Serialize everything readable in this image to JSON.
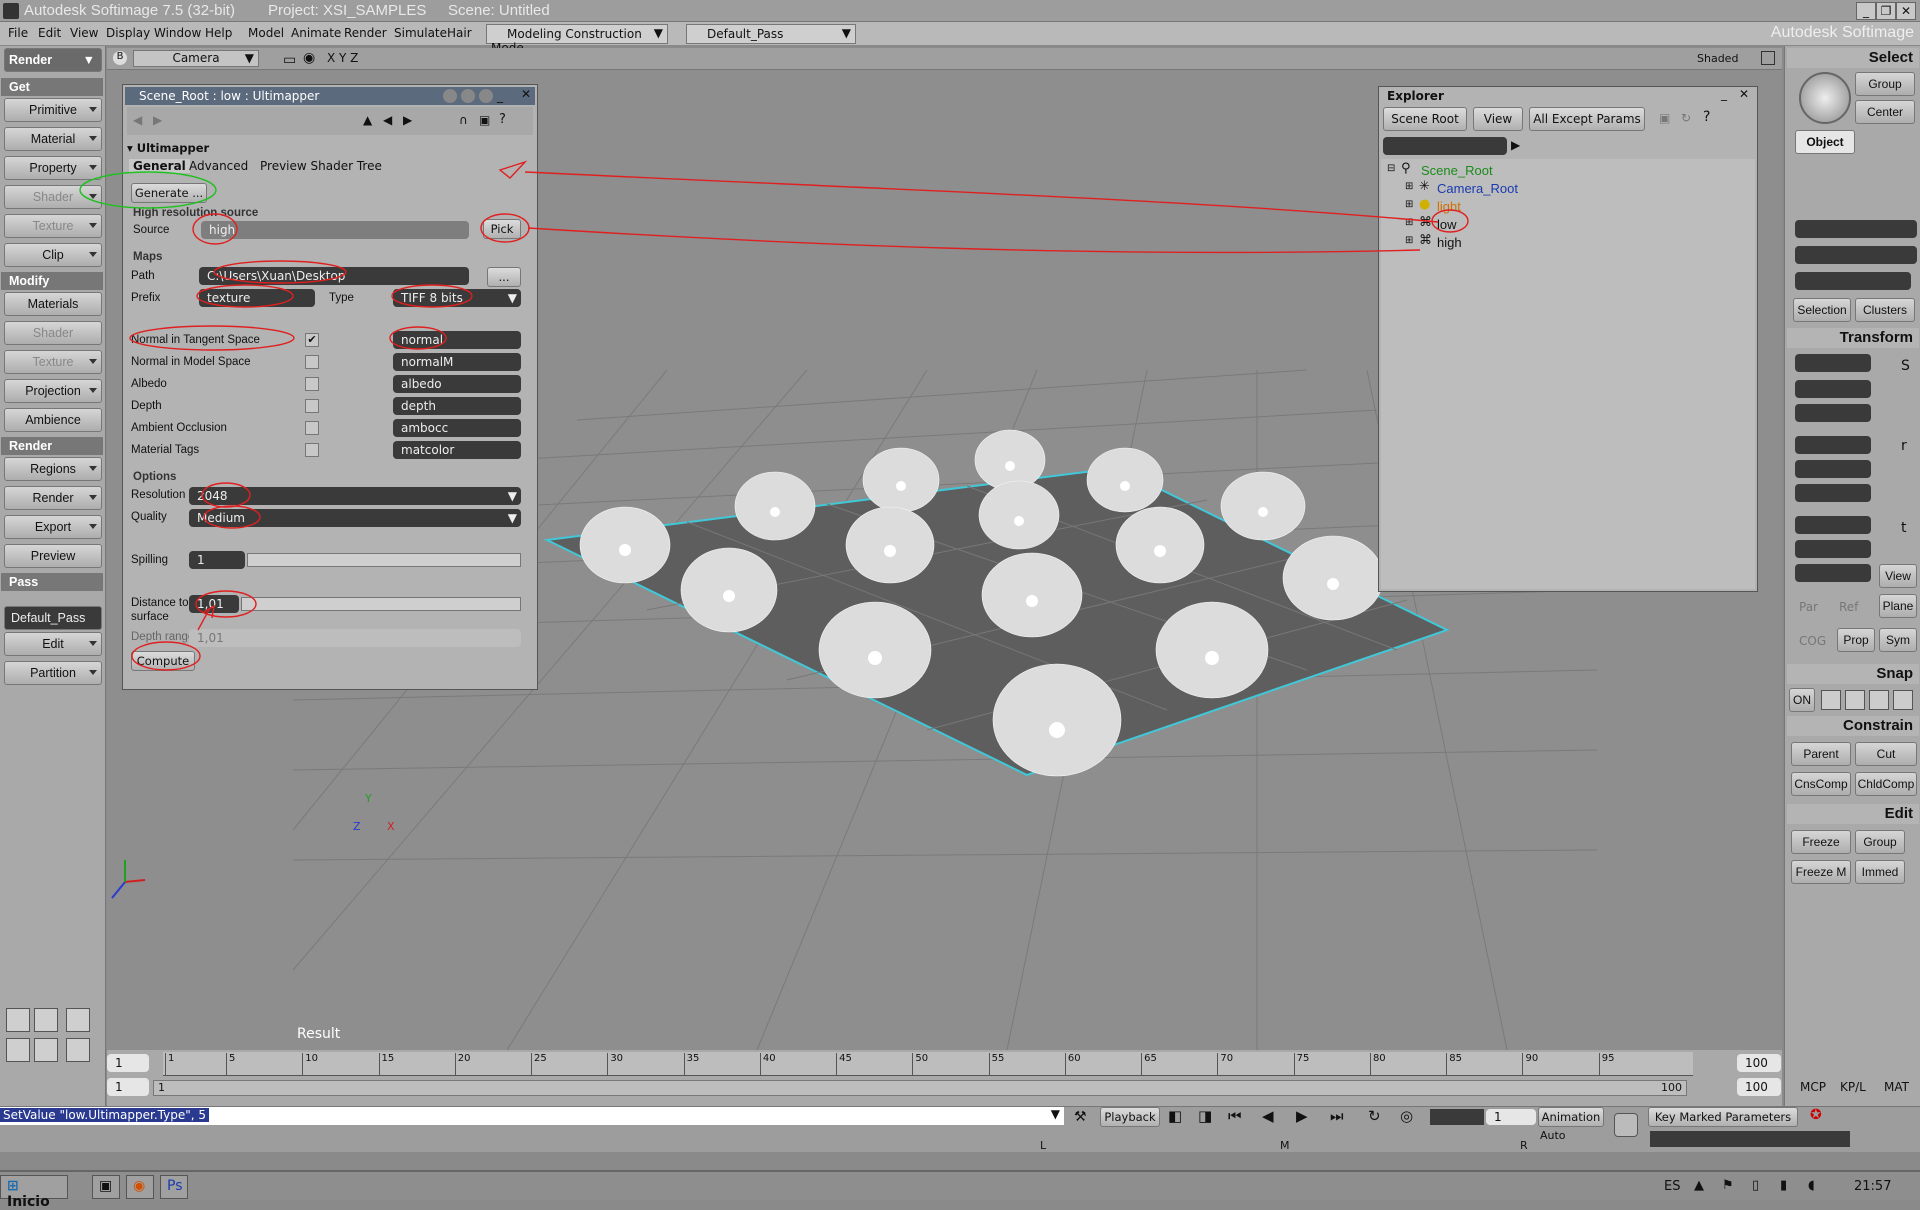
{
  "window": {
    "title_app": "Autodesk Softimage 7.5 (32-bit)",
    "title_project": "Project: XSI_SAMPLES",
    "title_scene": "Scene: Untitled",
    "brand": "Autodesk Softimage"
  },
  "menubar": {
    "items": [
      "File",
      "Edit",
      "View",
      "Display",
      "Window",
      "Help",
      "Model",
      "Animate",
      "Render",
      "Simulate",
      "Hair"
    ],
    "mode_combo": "Modeling Construction Mode",
    "pass_combo": "Default_Pass"
  },
  "left_panel": {
    "mode": "Render",
    "sections": {
      "get": "Get",
      "modify": "Modify",
      "render": "Render",
      "pass": "Pass"
    },
    "get_items": [
      "Primitive",
      "Material",
      "Property",
      "Shader",
      "Texture",
      "Clip"
    ],
    "modify_items": [
      "Materials",
      "Shader",
      "Texture",
      "Projection",
      "Ambience"
    ],
    "render_items": [
      "Regions",
      "Render",
      "Export",
      "Preview"
    ],
    "pass_value": "Default_Pass",
    "pass_items": [
      "Edit",
      "Partition"
    ]
  },
  "viewport": {
    "camera": "Camera",
    "axes_label": "X Y Z",
    "shading": "Shaded",
    "result_label": "Result",
    "axis_x": "X",
    "axis_y": "Y",
    "axis_z": "Z"
  },
  "ultimapper": {
    "title": "Scene_Root : low : Ultimapper",
    "section": "Ultimapper",
    "tabs": [
      "General",
      "Advanced",
      "Preview Shader Tree"
    ],
    "generate_btn": "Generate ...",
    "hires_section": "High resolution source",
    "source_label": "Source",
    "source_value": "high",
    "pick_btn": "Pick",
    "maps_section": "Maps",
    "path_label": "Path",
    "path_value": "C:\\Users\\Xuan\\Desktop",
    "browse_btn": "...",
    "prefix_label": "Prefix",
    "prefix_value": "texture",
    "type_label": "Type",
    "type_value": "TIFF 8 bits",
    "maps": [
      {
        "label": "Normal in Tangent Space",
        "checked": true,
        "name": "normal"
      },
      {
        "label": "Normal in Model Space",
        "checked": false,
        "name": "normalM"
      },
      {
        "label": "Albedo",
        "checked": false,
        "name": "albedo"
      },
      {
        "label": "Depth",
        "checked": false,
        "name": "depth"
      },
      {
        "label": "Ambient Occlusion",
        "checked": false,
        "name": "ambocc"
      },
      {
        "label": "Material Tags",
        "checked": false,
        "name": "matcolor"
      }
    ],
    "options_section": "Options",
    "resolution_label": "Resolution",
    "resolution_value": "2048",
    "quality_label": "Quality",
    "quality_value": "Medium",
    "spilling_label": "Spilling",
    "spilling_value": "1",
    "distance_label_1": "Distance to",
    "distance_label_2": "surface",
    "distance_value": "1,01",
    "depth_range_label": "Depth range",
    "depth_range_value": "1,01",
    "compute_btn": "Compute"
  },
  "explorer": {
    "title": "Explorer",
    "scope_btn": "Scene Root",
    "view_btn": "View",
    "filter_btn": "All Except Params",
    "tree": [
      {
        "label": "Scene_Root",
        "color": "#1a8a1a"
      },
      {
        "label": "Camera_Root",
        "color": "#1a3ab0"
      },
      {
        "label": "light",
        "color": "#d07000"
      },
      {
        "label": "low",
        "color": "#111111"
      },
      {
        "label": "high",
        "color": "#111111"
      }
    ]
  },
  "right_panel": {
    "select_header": "Select",
    "group_btn": "Group",
    "center_btn": "Center",
    "object_btn": "Object",
    "selection_btn": "Selection",
    "clusters_btn": "Clusters",
    "transform_header": "Transform",
    "view_btn": "View",
    "par_btn": "Par",
    "ref_btn": "Ref",
    "plane_btn": "Plane",
    "cog_btn": "COG",
    "prop_btn": "Prop",
    "sym_btn": "Sym",
    "snap_header": "Snap",
    "on_btn": "ON",
    "constrain_header": "Constrain",
    "parent_btn": "Parent",
    "cut_btn": "Cut",
    "cnscomp_btn": "CnsComp",
    "chldcomp_btn": "ChldComp",
    "edit_header": "Edit",
    "freeze_btn": "Freeze",
    "group2_btn": "Group",
    "freezem_btn": "Freeze M",
    "immed_btn": "Immed"
  },
  "timeline": {
    "start": "1",
    "end": "100",
    "ticks": [
      "1",
      "5",
      "10",
      "15",
      "20",
      "25",
      "30",
      "35",
      "40",
      "45",
      "50",
      "55",
      "60",
      "65",
      "70",
      "75",
      "80",
      "85",
      "90",
      "95"
    ],
    "range_start": "1",
    "range_inner": "1",
    "range_end_inner": "100",
    "range_end": "100",
    "mcp": "MCP",
    "kpl": "KP/L",
    "mat": "MAT"
  },
  "statusbar": {
    "command": "SetValue \"low.Ultimapper.Type\", 5",
    "playback": "Playback",
    "frame": "1",
    "animation": "Animation",
    "auto": "Auto",
    "key_marked": "Key Marked Parameters",
    "l": "L",
    "m": "M",
    "r": "R"
  },
  "taskbar": {
    "start": "Inicio",
    "lang": "ES",
    "clock": "21:57"
  },
  "colors": {
    "annotation": "#e02020",
    "selection_edge": "#40c8d8"
  }
}
